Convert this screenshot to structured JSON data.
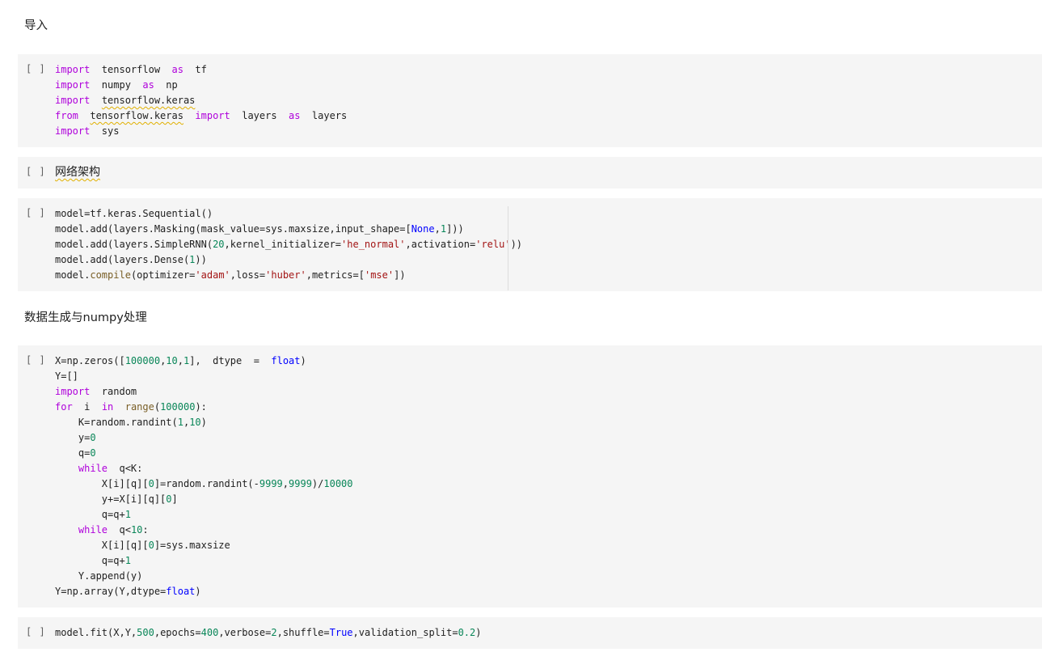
{
  "run_button_label": "[ ]",
  "sections": {
    "import_heading": "导入",
    "network_heading": "网络架构",
    "data_heading": "数据生成与numpy处理"
  },
  "cell1": [
    [
      [
        "kw",
        "import"
      ],
      [
        "t",
        "  tensorflow  "
      ],
      [
        "kw",
        "as"
      ],
      [
        "t",
        "  tf"
      ]
    ],
    [
      [
        "kw",
        "import"
      ],
      [
        "t",
        "  numpy  "
      ],
      [
        "kw",
        "as"
      ],
      [
        "t",
        "  np"
      ]
    ],
    [
      [
        "kw",
        "import"
      ],
      [
        "t",
        "  "
      ],
      [
        "sq",
        "tensorflow.keras"
      ]
    ],
    [
      [
        "kw",
        "from"
      ],
      [
        "t",
        "  "
      ],
      [
        "sq",
        "tensorflow.keras"
      ],
      [
        "t",
        "  "
      ],
      [
        "kw",
        "import"
      ],
      [
        "t",
        "  layers  "
      ],
      [
        "kw",
        "as"
      ],
      [
        "t",
        "  layers"
      ]
    ],
    [
      [
        "kw",
        "import"
      ],
      [
        "t",
        "  sys"
      ]
    ]
  ],
  "cell3": [
    [
      [
        "t",
        "model=tf.keras.Sequential()"
      ]
    ],
    [
      [
        "t",
        "model.add(layers.Masking(mask_value=sys.maxsize,input_shape=["
      ],
      [
        "kb",
        "None"
      ],
      [
        "t",
        ","
      ],
      [
        "num",
        "1"
      ],
      [
        "t",
        "]))"
      ]
    ],
    [
      [
        "t",
        "model.add(layers.SimpleRNN("
      ],
      [
        "num",
        "20"
      ],
      [
        "t",
        ",kernel_initializer="
      ],
      [
        "str",
        "'he_normal'"
      ],
      [
        "t",
        ",activation="
      ],
      [
        "str",
        "'relu'"
      ],
      [
        "t",
        "))"
      ]
    ],
    [
      [
        "t",
        "model.add(layers.Dense("
      ],
      [
        "num",
        "1"
      ],
      [
        "t",
        "))"
      ]
    ],
    [
      [
        "t",
        "model."
      ],
      [
        "fn",
        "compile"
      ],
      [
        "t",
        "(optimizer="
      ],
      [
        "str",
        "'adam'"
      ],
      [
        "t",
        ",loss="
      ],
      [
        "str",
        "'huber'"
      ],
      [
        "t",
        ",metrics=["
      ],
      [
        "str",
        "'mse'"
      ],
      [
        "t",
        "])"
      ]
    ]
  ],
  "cell4": [
    [
      [
        "t",
        "X=np.zeros(["
      ],
      [
        "num",
        "100000"
      ],
      [
        "t",
        ","
      ],
      [
        "num",
        "10"
      ],
      [
        "t",
        ","
      ],
      [
        "num",
        "1"
      ],
      [
        "t",
        "],  dtype  =  "
      ],
      [
        "kb",
        "float"
      ],
      [
        "t",
        ")"
      ]
    ],
    [
      [
        "t",
        "Y=[]"
      ]
    ],
    [
      [
        "kw",
        "import"
      ],
      [
        "t",
        "  random"
      ]
    ],
    [
      [
        "kw",
        "for"
      ],
      [
        "t",
        "  i  "
      ],
      [
        "kw",
        "in"
      ],
      [
        "t",
        "  "
      ],
      [
        "fn",
        "range"
      ],
      [
        "t",
        "("
      ],
      [
        "num",
        "100000"
      ],
      [
        "t",
        "):"
      ]
    ],
    [
      [
        "t",
        "    K=random.randint("
      ],
      [
        "num",
        "1"
      ],
      [
        "t",
        ","
      ],
      [
        "num",
        "10"
      ],
      [
        "t",
        ")"
      ]
    ],
    [
      [
        "t",
        "    y="
      ],
      [
        "num",
        "0"
      ]
    ],
    [
      [
        "t",
        "    q="
      ],
      [
        "num",
        "0"
      ]
    ],
    [
      [
        "t",
        "    "
      ],
      [
        "kw",
        "while"
      ],
      [
        "t",
        "  q<K:"
      ]
    ],
    [
      [
        "t",
        "        X[i][q]["
      ],
      [
        "num",
        "0"
      ],
      [
        "t",
        "]=random.randint(-"
      ],
      [
        "num",
        "9999"
      ],
      [
        "t",
        ","
      ],
      [
        "num",
        "9999"
      ],
      [
        "t",
        ")/"
      ],
      [
        "num",
        "10000"
      ]
    ],
    [
      [
        "t",
        "        y+=X[i][q]["
      ],
      [
        "num",
        "0"
      ],
      [
        "t",
        "]"
      ]
    ],
    [
      [
        "t",
        "        q=q+"
      ],
      [
        "num",
        "1"
      ]
    ],
    [
      [
        "t",
        "    "
      ],
      [
        "kw",
        "while"
      ],
      [
        "t",
        "  q<"
      ],
      [
        "num",
        "10"
      ],
      [
        "t",
        ":"
      ]
    ],
    [
      [
        "t",
        "        X[i][q]["
      ],
      [
        "num",
        "0"
      ],
      [
        "t",
        "]=sys.maxsize"
      ]
    ],
    [
      [
        "t",
        "        q=q+"
      ],
      [
        "num",
        "1"
      ]
    ],
    [
      [
        "t",
        "    Y.append(y)"
      ]
    ],
    [
      [
        "t",
        "Y=np.array(Y,dtype="
      ],
      [
        "kb",
        "float"
      ],
      [
        "t",
        ")"
      ]
    ]
  ],
  "cell5": [
    [
      [
        "t",
        "model.fit(X,Y,"
      ],
      [
        "num",
        "500"
      ],
      [
        "t",
        ",epochs="
      ],
      [
        "num",
        "400"
      ],
      [
        "t",
        ",verbose="
      ],
      [
        "num",
        "2"
      ],
      [
        "t",
        ",shuffle="
      ],
      [
        "kb",
        "True"
      ],
      [
        "t",
        ",validation_split="
      ],
      [
        "num",
        "0.2"
      ],
      [
        "t",
        ")"
      ]
    ]
  ]
}
